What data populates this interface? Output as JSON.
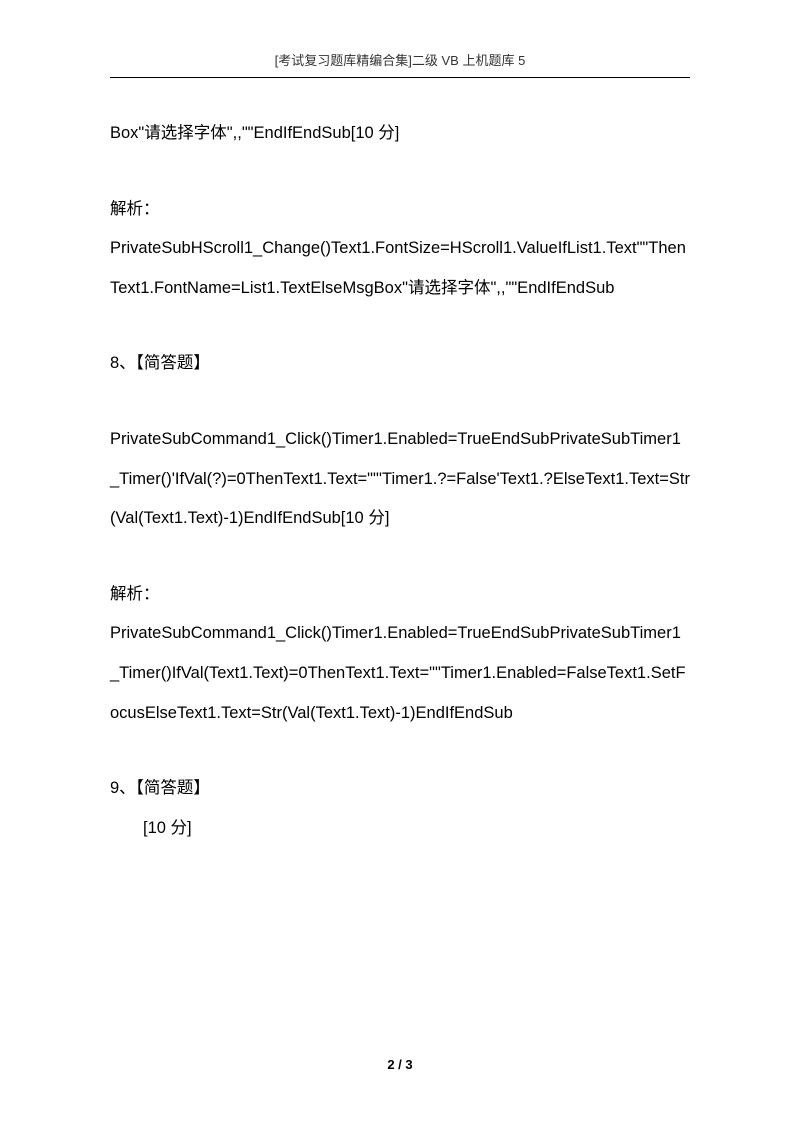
{
  "header": {
    "text": "[考试复习题库精编合集]二级 VB 上机题库 5"
  },
  "paragraphs": {
    "p1": "Box\"请选择字体\",,\"\"EndIfEndSub[10 分]",
    "p2_label": "解析：",
    "p2_body": "PrivateSubHScroll1_Change()Text1.FontSize=HScroll1.ValueIfList1.Text\"\"ThenText1.FontName=List1.TextElseMsgBox\"请选择字体\",,\"\"EndIfEndSub",
    "p3": "8、【简答题】",
    "p4": "PrivateSubCommand1_Click()Timer1.Enabled=TrueEndSubPrivateSubTimer1_Timer()'IfVal(?)=0ThenText1.Text=\"\"'Timer1.?=False'Text1.?ElseText1.Text=Str(Val(Text1.Text)-1)EndIfEndSub[10 分]",
    "p5_label": "解析：",
    "p5_body": "PrivateSubCommand1_Click()Timer1.Enabled=TrueEndSubPrivateSubTimer1_Timer()IfVal(Text1.Text)=0ThenText1.Text=\"\"Timer1.Enabled=FalseText1.SetFocusElseText1.Text=Str(Val(Text1.Text)-1)EndIfEndSub",
    "p6_line1": "9、【简答题】",
    "p6_line2": "[10 分]"
  },
  "footer": {
    "page_number": "2 / 3"
  }
}
